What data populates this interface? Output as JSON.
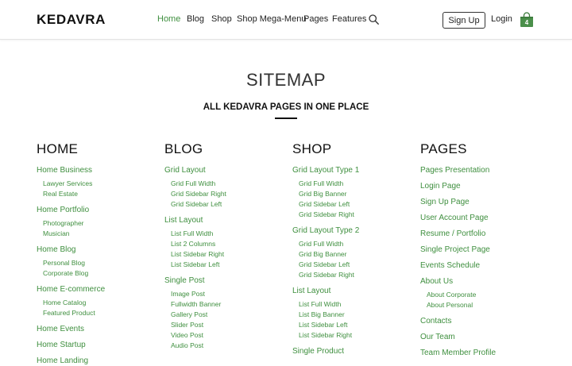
{
  "header": {
    "logo": "KEDAVRA",
    "nav": [
      {
        "label": "Home",
        "active": true
      },
      {
        "label": "Blog",
        "active": false
      },
      {
        "label": "Shop",
        "active": false
      },
      {
        "label": "Shop Mega-Menu",
        "active": false
      },
      {
        "label": "Pages",
        "active": false
      },
      {
        "label": "Features",
        "active": false
      }
    ],
    "search_icon": "search-icon",
    "signup_label": "Sign Up",
    "login_label": "Login",
    "cart_icon": "shopping-bag-icon",
    "cart_count": "4"
  },
  "colors": {
    "accent": "#3f8f3f",
    "text": "#222222",
    "cart": "#4a8f4a"
  },
  "hero": {
    "title": "SITEMAP",
    "subtitle": "ALL KEDAVRA PAGES IN ONE PLACE"
  },
  "columns": [
    {
      "heading": "HOME",
      "items": [
        {
          "type": "main",
          "label": "Home Business"
        },
        {
          "type": "sub",
          "label": "Lawyer Services"
        },
        {
          "type": "sub",
          "label": "Real Estate"
        },
        {
          "type": "main",
          "label": "Home Portfolio"
        },
        {
          "type": "sub",
          "label": "Photographer"
        },
        {
          "type": "sub",
          "label": "Musician"
        },
        {
          "type": "main",
          "label": "Home Blog"
        },
        {
          "type": "sub",
          "label": "Personal Blog"
        },
        {
          "type": "sub",
          "label": "Corporate Blog"
        },
        {
          "type": "main",
          "label": "Home E-commerce"
        },
        {
          "type": "sub",
          "label": "Home Catalog"
        },
        {
          "type": "sub",
          "label": "Featured Product"
        },
        {
          "type": "main",
          "label": "Home Events"
        },
        {
          "type": "main",
          "label": "Home Startup"
        },
        {
          "type": "main",
          "label": "Home Landing"
        }
      ]
    },
    {
      "heading": "BLOG",
      "items": [
        {
          "type": "main",
          "label": "Grid Layout"
        },
        {
          "type": "sub",
          "label": "Grid Full Width"
        },
        {
          "type": "sub",
          "label": "Grid Sidebar Right"
        },
        {
          "type": "sub",
          "label": "Grid Sidebar Left"
        },
        {
          "type": "main",
          "label": "List Layout"
        },
        {
          "type": "sub",
          "label": "List Full Width"
        },
        {
          "type": "sub",
          "label": "List 2 Columns"
        },
        {
          "type": "sub",
          "label": "List Sidebar Right"
        },
        {
          "type": "sub",
          "label": "List Sidebar Left"
        },
        {
          "type": "main",
          "label": "Single Post"
        },
        {
          "type": "sub",
          "label": "Image Post"
        },
        {
          "type": "sub",
          "label": "Fullwidth Banner"
        },
        {
          "type": "sub",
          "label": "Gallery Post"
        },
        {
          "type": "sub",
          "label": "Slider Post"
        },
        {
          "type": "sub",
          "label": "Video Post"
        },
        {
          "type": "sub",
          "label": "Audio Post"
        }
      ]
    },
    {
      "heading": "SHOP",
      "items": [
        {
          "type": "main",
          "label": "Grid Layout Type 1"
        },
        {
          "type": "sub",
          "label": "Grid Full Width"
        },
        {
          "type": "sub",
          "label": "Grid Big Banner"
        },
        {
          "type": "sub",
          "label": "Grid Sidebar Left"
        },
        {
          "type": "sub",
          "label": "Grid Sidebar Right"
        },
        {
          "type": "main",
          "label": "Grid Layout Type 2"
        },
        {
          "type": "sub",
          "label": "Grid Full Width"
        },
        {
          "type": "sub",
          "label": "Grid Big Banner"
        },
        {
          "type": "sub",
          "label": "Grid Sidebar Left"
        },
        {
          "type": "sub",
          "label": "Grid Sidebar Right"
        },
        {
          "type": "main",
          "label": "List Layout"
        },
        {
          "type": "sub",
          "label": "List Full Width"
        },
        {
          "type": "sub",
          "label": "List Big Banner"
        },
        {
          "type": "sub",
          "label": "List Sidebar Left"
        },
        {
          "type": "sub",
          "label": "List Sidebar Right"
        },
        {
          "type": "main",
          "label": "Single Product"
        }
      ]
    },
    {
      "heading": "PAGES",
      "items": [
        {
          "type": "main",
          "label": "Pages Presentation"
        },
        {
          "type": "main",
          "label": "Login Page"
        },
        {
          "type": "main",
          "label": "Sign Up Page"
        },
        {
          "type": "main",
          "label": "User Account Page"
        },
        {
          "type": "main",
          "label": "Resume / Portfolio"
        },
        {
          "type": "main",
          "label": "Single Project Page"
        },
        {
          "type": "main",
          "label": "Events Schedule"
        },
        {
          "type": "main",
          "label": "About Us"
        },
        {
          "type": "sub",
          "label": "About Corporate"
        },
        {
          "type": "sub",
          "label": "About Personal"
        },
        {
          "type": "main",
          "label": "Contacts"
        },
        {
          "type": "main",
          "label": "Our Team"
        },
        {
          "type": "main",
          "label": "Team Member Profile"
        }
      ]
    }
  ]
}
